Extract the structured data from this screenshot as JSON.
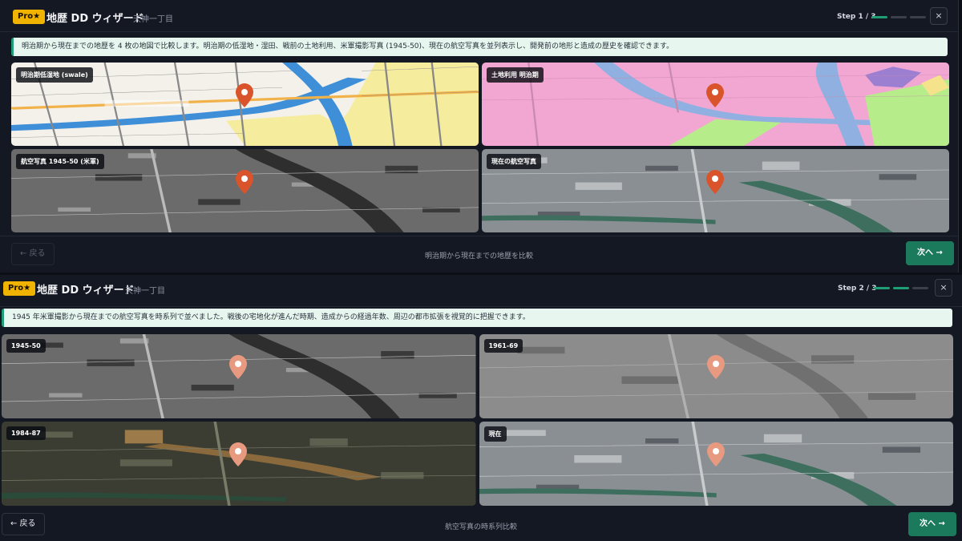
{
  "colors": {
    "accent": "#1f9e75",
    "badge": "#f0b400",
    "pin": "#d9542b",
    "info_bg": "#e8f6f0"
  },
  "panel1": {
    "badge": "Pro★",
    "title": "地歴 DD ウィザード",
    "location": "天神一丁目",
    "step": "Step 1 / 3",
    "step_progress": {
      "current": 1,
      "total": 3
    },
    "close_icon": "×",
    "info": "明治期から現在までの地歴を 4 枚の地図で比較します。明治期の低湿地・湿田、戦前の土地利用、米軍撮影写真 (1945-50)、現在の航空写真を並列表示し、開発前の地形と造成の歴史を確認できます。",
    "tiles": [
      {
        "label": "明治期低湿地 (swale)",
        "kind": "map-old"
      },
      {
        "label": "土地利用 明治期",
        "kind": "landuse"
      },
      {
        "label": "航空写真 1945-50 (米軍)",
        "kind": "bw"
      },
      {
        "label": "現在の航空写真",
        "kind": "color"
      }
    ],
    "back": "← 戻る",
    "back_enabled": false,
    "footer": "明治期から現在までの地歴を比較",
    "next": "次へ →"
  },
  "panel2": {
    "badge": "Pro★",
    "title": "地歴 DD ウィザード",
    "location": "天神一丁目",
    "step": "Step 2 / 3",
    "step_progress": {
      "current": 2,
      "total": 3
    },
    "close_icon": "×",
    "info": "1945 年米軍撮影から現在までの航空写真を時系列で並べました。戦後の宅地化が進んだ時期、造成からの経過年数、周辺の都市拡張を視覚的に把握できます。",
    "tiles": [
      {
        "label": "1945-50",
        "kind": "bw"
      },
      {
        "label": "1961-69",
        "kind": "gray"
      },
      {
        "label": "1984-87",
        "kind": "dark"
      },
      {
        "label": "現在",
        "kind": "color"
      }
    ],
    "back": "← 戻る",
    "back_enabled": true,
    "footer": "航空写真の時系列比較",
    "next": "次へ →"
  }
}
